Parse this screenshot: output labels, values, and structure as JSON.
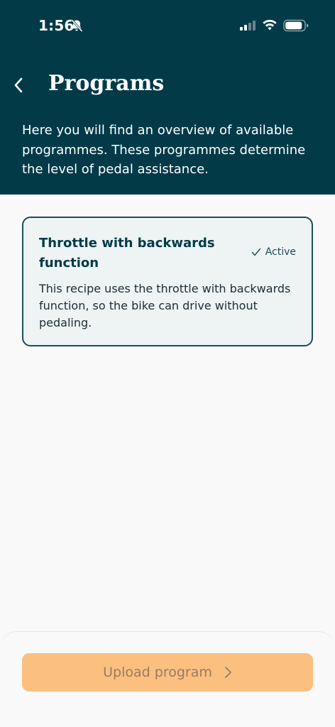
{
  "status_bar": {
    "time": "1:56",
    "icons": [
      "bell-slash-icon",
      "cellular-signal-icon",
      "wifi-icon",
      "battery-icon"
    ]
  },
  "header": {
    "back_icon": "chevron-left-icon",
    "title": "Programs",
    "description": "Here you will find an overview of available programmes. These programmes determine the level of pedal assistance."
  },
  "programs": [
    {
      "title": "Throttle with backwards function",
      "status": "Active",
      "status_icon": "checkmark-icon",
      "description": "This recipe uses the throttle with backwards function, so the bike can drive without pedaling."
    }
  ],
  "footer": {
    "upload_label": "Upload program",
    "upload_icon": "chevron-right-icon"
  },
  "colors": {
    "header_bg": "#023a48",
    "card_bg": "#eef3f4",
    "card_border": "#1c4d57",
    "button_bg": "#fbc07f",
    "button_text": "#9a7a63",
    "page_bg": "#f9f9f9"
  }
}
